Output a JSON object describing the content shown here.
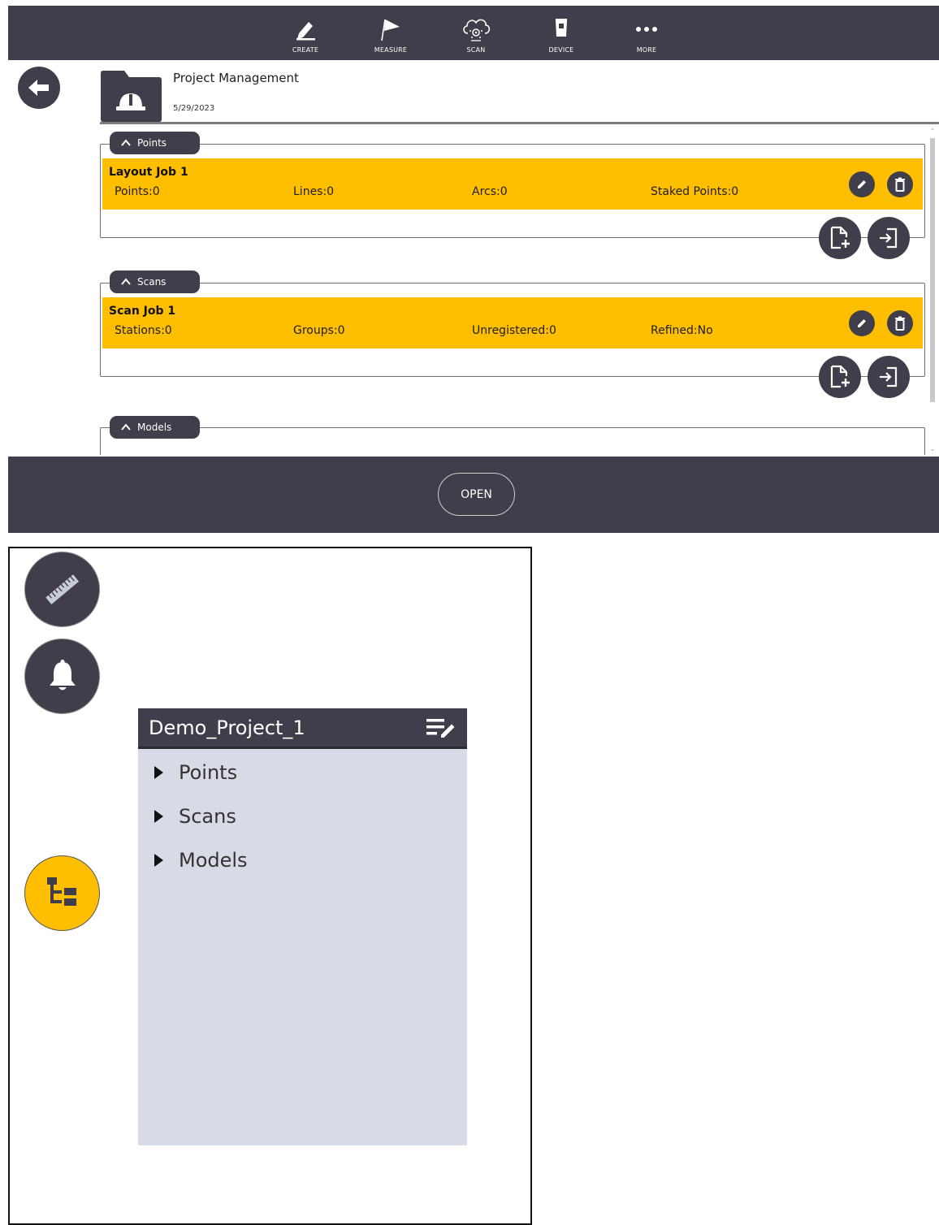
{
  "topbar": {
    "items": [
      {
        "label": "CREATE",
        "icon": "pencil-icon"
      },
      {
        "label": "MEASURE",
        "icon": "flag-icon"
      },
      {
        "label": "SCAN",
        "icon": "cloud-scan-icon"
      },
      {
        "label": "DEVICE",
        "icon": "device-icon"
      },
      {
        "label": "MORE",
        "icon": "more-dots-icon"
      }
    ]
  },
  "header": {
    "project_name": "Project Management",
    "date": "5/29/2023",
    "back_icon": "arrow-left-icon",
    "folder_icon": "hardhat-folder-icon"
  },
  "groups": {
    "points": {
      "tab_label": "Points",
      "job": {
        "title": "Layout Job 1",
        "stats": [
          "Points:0",
          "Lines:0",
          "Arcs:0",
          "Staked Points:0"
        ]
      }
    },
    "scans": {
      "tab_label": "Scans",
      "job": {
        "title": "Scan Job 1",
        "stats": [
          "Stations:0",
          "Groups:0",
          "Unregistered:0",
          "Refined:No"
        ]
      }
    },
    "models": {
      "tab_label": "Models"
    }
  },
  "footer": {
    "open_label": "OPEN"
  },
  "tree": {
    "title": "Demo_Project_1",
    "items": [
      "Points",
      "Scans",
      "Models"
    ]
  },
  "colors": {
    "bar": "#3f3e4a",
    "accent": "#ffbe00",
    "tree_bg": "#d8dbe5"
  }
}
